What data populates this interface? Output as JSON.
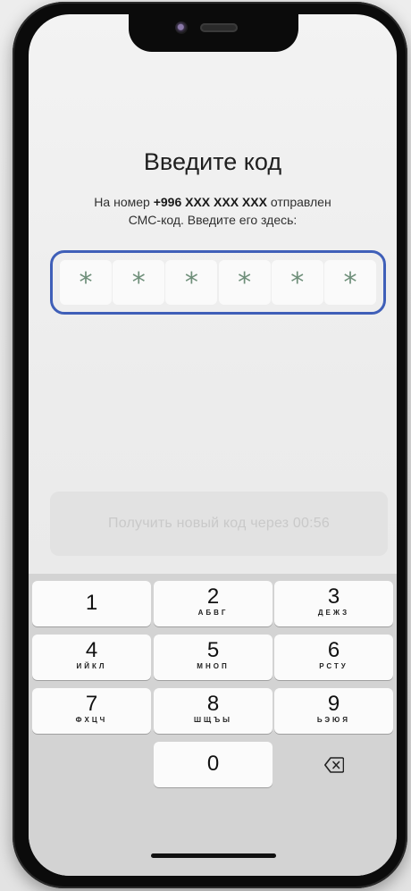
{
  "screen": {
    "title": "Введите код",
    "subtitle_prefix": "На номер",
    "phone_number": "+996 XXX XXX XXX",
    "subtitle_suffix": "отправлен",
    "subtitle_line2": "СМС-код. Введите его здесь:"
  },
  "code": {
    "cells": [
      "*",
      "*",
      "*",
      "*",
      "*",
      "*"
    ]
  },
  "resend": {
    "label": "Получить новый код через 00:56"
  },
  "keypad": {
    "keys": [
      {
        "digit": "1",
        "letters": ""
      },
      {
        "digit": "2",
        "letters": "АБВГ"
      },
      {
        "digit": "3",
        "letters": "ДЕЖЗ"
      },
      {
        "digit": "4",
        "letters": "ИЙКЛ"
      },
      {
        "digit": "5",
        "letters": "МНОП"
      },
      {
        "digit": "6",
        "letters": "РСТУ"
      },
      {
        "digit": "7",
        "letters": "ФХЦЧ"
      },
      {
        "digit": "8",
        "letters": "ШЩЪЫ"
      },
      {
        "digit": "9",
        "letters": "ЬЭЮЯ"
      },
      {
        "digit": "0",
        "letters": ""
      }
    ],
    "backspace_icon": "backspace-icon"
  },
  "colors": {
    "accent_border": "#3f5fb8",
    "asterisk": "#6f8f7a",
    "disabled_text": "#c9c9c9"
  }
}
